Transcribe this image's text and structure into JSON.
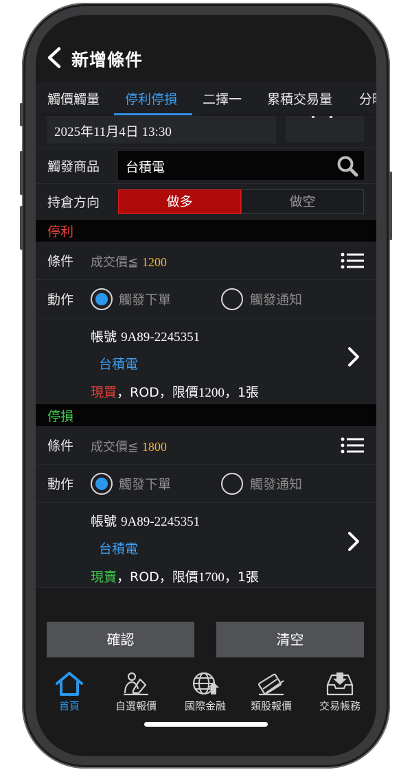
{
  "header": {
    "title": "新增條件"
  },
  "tabs": [
    {
      "label": "觸價觸量",
      "active": false
    },
    {
      "label": "停利停損",
      "active": true
    },
    {
      "label": "二擇一",
      "active": false
    },
    {
      "label": "累積交易量",
      "active": false
    },
    {
      "label": "分時",
      "active": false
    }
  ],
  "datetime": "2025年11月4日 13:30",
  "trigger_stock": {
    "label": "觸發商品",
    "value": "台積電"
  },
  "direction": {
    "label": "持倉方向",
    "long_label": "做多",
    "short_label": "做空",
    "selected": "long"
  },
  "take_profit": {
    "heading": "停利",
    "condition_label": "條件",
    "condition_prefix": "成交價≦",
    "condition_value": "1200",
    "action_label": "動作",
    "action_options": [
      {
        "label": "觸發下單",
        "selected": true
      },
      {
        "label": "觸發通知",
        "selected": false
      }
    ],
    "account_prefix": "帳號",
    "account": "9A89-2245351",
    "stock": "台積電",
    "side": "現買",
    "order_details_a": "，ROD，限價",
    "order_price": "1200",
    "order_details_b": "，1張"
  },
  "stop_loss": {
    "heading": "停損",
    "condition_label": "條件",
    "condition_prefix": "成交價≦",
    "condition_value": "1800",
    "action_label": "動作",
    "action_options": [
      {
        "label": "觸發下單",
        "selected": true
      },
      {
        "label": "觸發通知",
        "selected": false
      }
    ],
    "account_prefix": "帳號",
    "account": "9A89-2245351",
    "stock": "台積電",
    "side": "現賣",
    "order_details_a": "，ROD，限價",
    "order_price": "1700",
    "order_details_b": "，1張"
  },
  "buttons": {
    "confirm": "確認",
    "clear": "清空"
  },
  "bottom_nav": [
    {
      "label": "首頁",
      "icon": "home-icon",
      "active": true
    },
    {
      "label": "自選報價",
      "icon": "watchlist-icon",
      "active": false
    },
    {
      "label": "國際金融",
      "icon": "globe-icon",
      "active": false
    },
    {
      "label": "類股報價",
      "icon": "sector-icon",
      "active": false
    },
    {
      "label": "交易帳務",
      "icon": "account-tray-icon",
      "active": false
    }
  ],
  "colors": {
    "accent": "#3b9ef2",
    "long_red": "#b00a0a",
    "take_profit_red": "#e8403a",
    "stop_loss_green": "#3cc84a",
    "price_gold": "#f2b733"
  }
}
